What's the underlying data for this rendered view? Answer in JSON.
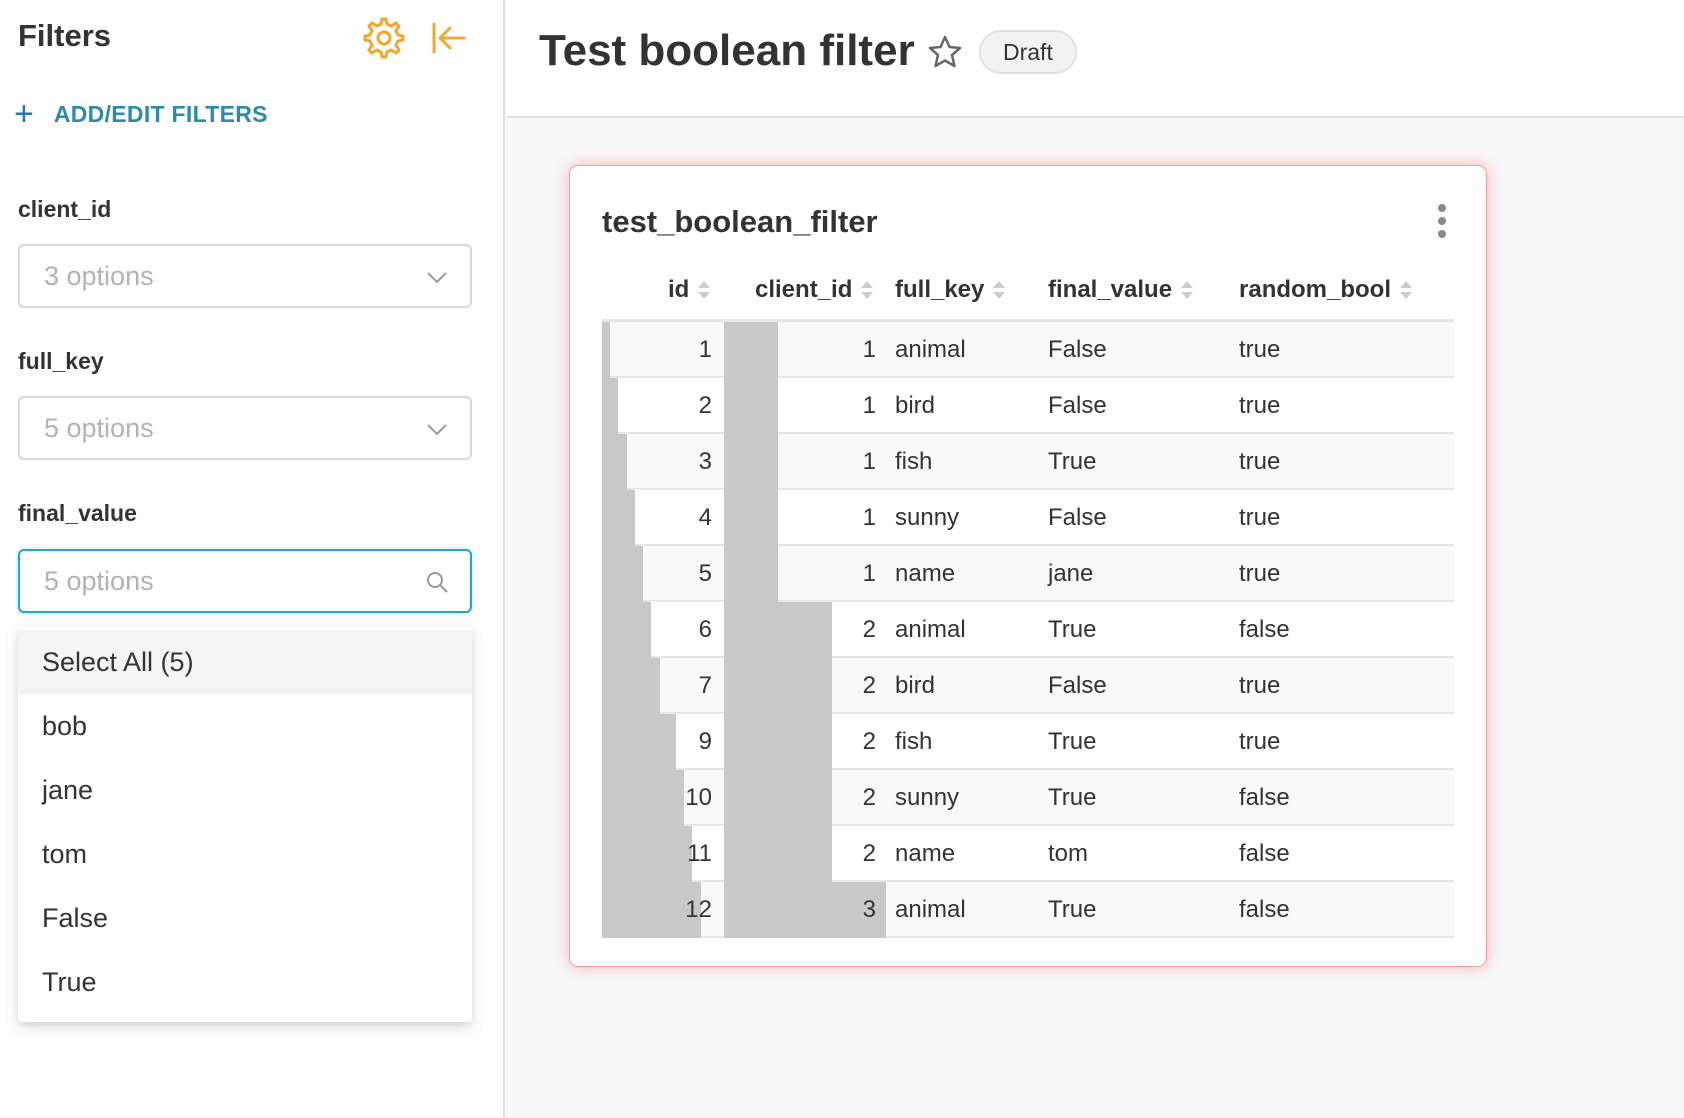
{
  "sidebar": {
    "title": "Filters",
    "add_filters_label": "ADD/EDIT FILTERS",
    "filters": [
      {
        "label": "client_id",
        "placeholder": "3 options"
      },
      {
        "label": "full_key",
        "placeholder": "5 options"
      },
      {
        "label": "final_value",
        "placeholder": "5 options"
      }
    ],
    "dropdown": {
      "items": [
        "Select All (5)",
        "bob",
        "jane",
        "tom",
        "False",
        "True"
      ]
    }
  },
  "header": {
    "title": "Test boolean filter",
    "status_badge": "Draft"
  },
  "chart": {
    "title": "test_boolean_filter",
    "columns": [
      "id",
      "client_id",
      "full_key",
      "final_value",
      "random_bool"
    ],
    "rows": [
      {
        "id": "1",
        "client_id": "1",
        "full_key": "animal",
        "final_value": "False",
        "random_bool": "true"
      },
      {
        "id": "2",
        "client_id": "1",
        "full_key": "bird",
        "final_value": "False",
        "random_bool": "true"
      },
      {
        "id": "3",
        "client_id": "1",
        "full_key": "fish",
        "final_value": "True",
        "random_bool": "true"
      },
      {
        "id": "4",
        "client_id": "1",
        "full_key": "sunny",
        "final_value": "False",
        "random_bool": "true"
      },
      {
        "id": "5",
        "client_id": "1",
        "full_key": "name",
        "final_value": "jane",
        "random_bool": "true"
      },
      {
        "id": "6",
        "client_id": "2",
        "full_key": "animal",
        "final_value": "True",
        "random_bool": "false"
      },
      {
        "id": "7",
        "client_id": "2",
        "full_key": "bird",
        "final_value": "False",
        "random_bool": "true"
      },
      {
        "id": "9",
        "client_id": "2",
        "full_key": "fish",
        "final_value": "True",
        "random_bool": "true"
      },
      {
        "id": "10",
        "client_id": "2",
        "full_key": "sunny",
        "final_value": "True",
        "random_bool": "false"
      },
      {
        "id": "11",
        "client_id": "2",
        "full_key": "name",
        "final_value": "tom",
        "random_bool": "false"
      },
      {
        "id": "12",
        "client_id": "3",
        "full_key": "animal",
        "final_value": "True",
        "random_bool": "false"
      }
    ]
  },
  "colors": {
    "accent_orange": "#f0a830",
    "link_teal": "#2d8aa8",
    "focus_blue": "#20a7c9",
    "card_glow": "#f06e6e",
    "cell_bar": "#c8c8c8"
  },
  "icons": {
    "settings": "gear-icon",
    "collapse": "collapse-left-icon",
    "add": "plus-icon",
    "select_arrow": "chevron-down-icon",
    "search": "search-icon",
    "favorite": "star-icon",
    "more": "more-vertical-icon",
    "sort": "sort-icon"
  }
}
